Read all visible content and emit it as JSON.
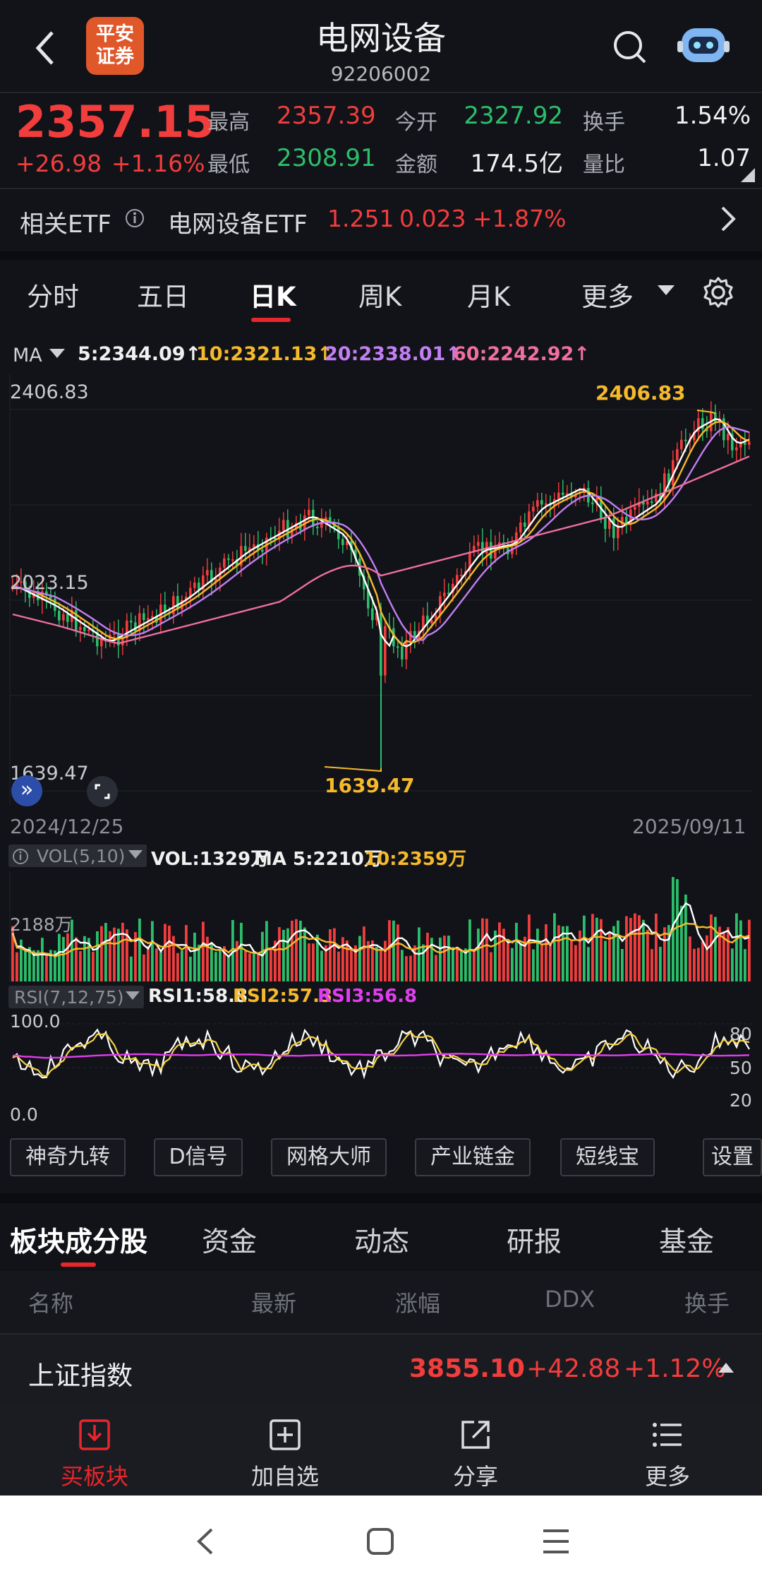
{
  "header": {
    "logo_text_1": "平安",
    "logo_text_2": "证券",
    "title": "电网设备",
    "code": "92206002"
  },
  "quote": {
    "price": "2357.15",
    "change": "+26.98",
    "change_pct": "+1.16%",
    "high_label": "最高",
    "high": "2357.39",
    "open_label": "今开",
    "open": "2327.92",
    "turnover_label": "换手",
    "turnover": "1.54%",
    "low_label": "最低",
    "low": "2308.91",
    "amount_label": "金额",
    "amount": "174.5亿",
    "vol_ratio_label": "量比",
    "vol_ratio": "1.07"
  },
  "etf": {
    "label": "相关ETF",
    "name": "电网设备ETF",
    "price": "1.251",
    "change": "0.023",
    "pct": "+1.87%"
  },
  "period_tabs": [
    "分时",
    "五日",
    "日K",
    "周K",
    "月K",
    "更多"
  ],
  "ma": {
    "label": "MA",
    "ma5": "5:2344.09↑",
    "ma10": "10:2321.13↑",
    "ma20": "20:2338.01↑",
    "ma60": "60:2242.92↑"
  },
  "kline": {
    "top_label": "2406.83",
    "mid_label": "2023.15",
    "bottom_label": "1639.47",
    "high_callout": "2406.83",
    "low_callout": "1639.47",
    "start_date": "2024/12/25",
    "end_date": "2025/09/11"
  },
  "vol": {
    "label": "VOL(5,10)",
    "vol": "VOL:1329万",
    "ma5": "MA 5:2210万",
    "ma10": "10:2359万",
    "axis": "2188万"
  },
  "rsi": {
    "label": "RSI(7,12,75)",
    "rsi1": "RSI1:58.8",
    "rsi2": "RSI2:57.3",
    "rsi3": "RSI3:56.8",
    "top": "100.0",
    "bottom": "0.0",
    "r80": "80",
    "r50": "50",
    "r20": "20"
  },
  "tools": [
    "神奇九转",
    "D信号",
    "网格大师",
    "产业链金",
    "短线宝",
    "设置"
  ],
  "section_tabs": [
    "板块成分股",
    "资金",
    "动态",
    "研报",
    "基金"
  ],
  "table_headers": [
    "名称",
    "最新",
    "涨幅",
    "DDX",
    "换手"
  ],
  "index_row": {
    "name": "上证指数",
    "price": "3855.10",
    "change": "+42.88",
    "pct": "+1.12%"
  },
  "bottom_bar": [
    "买板块",
    "加自选",
    "分享",
    "更多"
  ],
  "colors": {
    "up": "#f23d3d",
    "down": "#2bbf6b",
    "ma5": "#ffffff",
    "ma10": "#f5b92b",
    "ma20": "#c17ff3",
    "ma60": "#ef6fa0"
  }
}
